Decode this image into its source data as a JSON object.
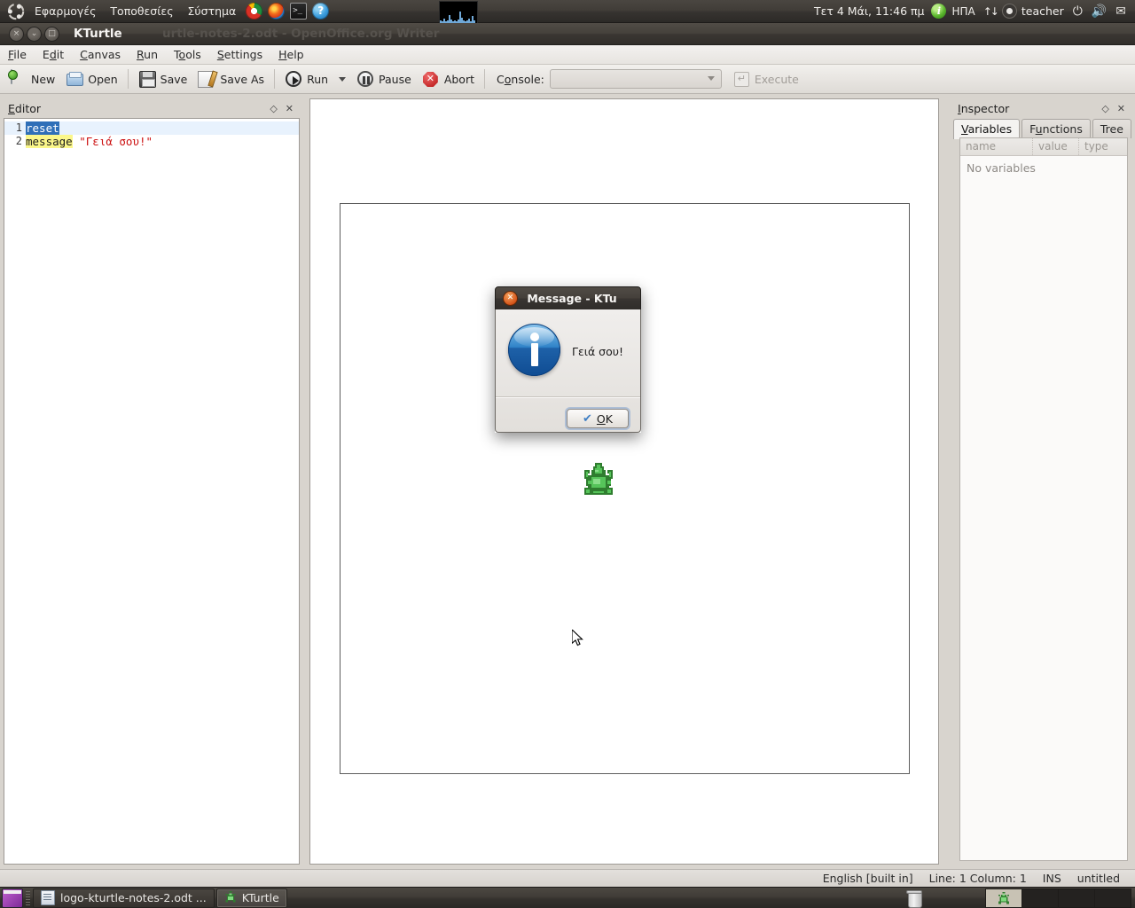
{
  "top_panel": {
    "menus": [
      "Εφαρμογές",
      "Τοποθεσίες",
      "Σύστημα"
    ],
    "launchers": [
      {
        "name": "chrome-icon",
        "label": "Google Chrome"
      },
      {
        "name": "firefox-icon",
        "label": "Firefox"
      },
      {
        "name": "terminal-icon",
        "label": "Terminal"
      },
      {
        "name": "help-icon",
        "label": "Help"
      }
    ],
    "terminal_glyph": ">_",
    "help_glyph": "?",
    "clock": "Τετ  4 Μάι, 11:46 πμ",
    "indicator_glyph": "i",
    "keyboard_layout": "ΗΠΑ",
    "network_glyph": "↑↓",
    "user": "teacher",
    "power_glyph": "⏻",
    "volume_glyph": "🔊",
    "mail_glyph": "✉"
  },
  "window": {
    "title": "KTurtle",
    "ghost_title": "urtle-notes-2.odt - OpenOffice.org Writer",
    "buttons": {
      "close": "×",
      "minimize": "⌄",
      "maximize": "□"
    }
  },
  "menubar": {
    "items": [
      {
        "pre": "",
        "accel": "F",
        "post": "ile"
      },
      {
        "pre": "E",
        "accel": "d",
        "post": "it"
      },
      {
        "pre": "",
        "accel": "C",
        "post": "anvas"
      },
      {
        "pre": "",
        "accel": "R",
        "post": "un"
      },
      {
        "pre": "T",
        "accel": "o",
        "post": "ols"
      },
      {
        "pre": "",
        "accel": "S",
        "post": "ettings"
      },
      {
        "pre": "",
        "accel": "H",
        "post": "elp"
      }
    ]
  },
  "toolbar": {
    "new_label": "New",
    "open_label": "Open",
    "save_label": "Save",
    "save_as_label": "Save As",
    "run_label": "Run",
    "pause_label": "Pause",
    "abort_label": "Abort",
    "console_label_pre": "C",
    "console_label_accel": "o",
    "console_label_post": "nsole:",
    "console_value": "",
    "console_placeholder": "",
    "execute_label": "Execute"
  },
  "editor": {
    "title": "Editor",
    "float_glyph": "◇",
    "close_glyph": "✕",
    "lines": [
      {
        "number": "1",
        "tokens": [
          {
            "text": "reset",
            "style": "sel"
          }
        ]
      },
      {
        "number": "2",
        "tokens": [
          {
            "text": "message",
            "style": "cmd"
          },
          {
            "text": " ",
            "style": "plain"
          },
          {
            "text": "\"Γειά σου!\"",
            "style": "str"
          }
        ]
      }
    ]
  },
  "canvas": {
    "turtle_name": "turtle-sprite"
  },
  "inspector": {
    "title": "Inspector",
    "float_glyph": "◇",
    "close_glyph": "✕",
    "tabs": [
      {
        "pre": "",
        "accel": "V",
        "post": "ariables",
        "active": true
      },
      {
        "pre": "F",
        "accel": "u",
        "post": "nctions",
        "active": false
      },
      {
        "pre": "Tree",
        "accel": "",
        "post": "",
        "active": false
      }
    ],
    "columns": [
      "name",
      "value",
      "type"
    ],
    "empty_text": "No variables"
  },
  "dialog": {
    "title": "Message - KTu",
    "close_glyph": "✕",
    "icon_name": "info-icon",
    "message": "Γειά σου!",
    "ok_pre": "",
    "ok_accel": "O",
    "ok_post": "K",
    "check_glyph": "✔"
  },
  "statusbar": {
    "language": "English [built in]",
    "position": "Line: 1 Column: 1",
    "mode": "INS",
    "filename": "untitled"
  },
  "taskbar": {
    "tasks": [
      {
        "label": "logo-kturtle-notes-2.odt ...",
        "active": false,
        "icon": "document-icon"
      },
      {
        "label": "KTurtle",
        "active": true,
        "icon": "kturtle-icon"
      }
    ],
    "trash_name": "trash-icon",
    "workspaces": 4,
    "active_workspace": 1
  },
  "colors": {
    "panel_dark": "#3b3733",
    "accent_orange": "#d4541a",
    "selection_blue": "#2f6fb8",
    "keyword_yellow": "#fbf78a",
    "string_red": "#cc1111",
    "turtle_green": "#3faa3f",
    "info_blue": "#1e61a8"
  }
}
